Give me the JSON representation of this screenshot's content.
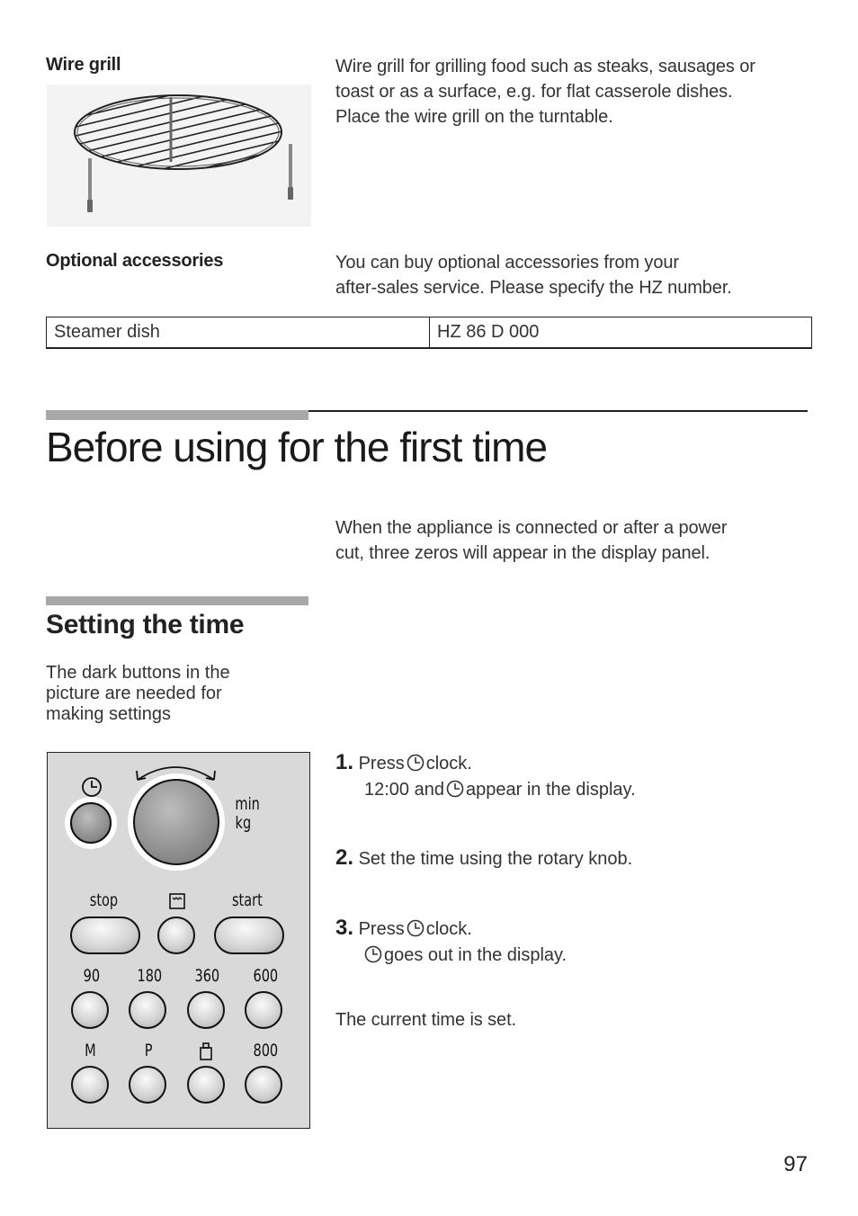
{
  "wire_grill": {
    "label": "Wire grill",
    "description_lines": [
      "Wire grill for grilling food such as steaks, sausages or",
      "toast or as a surface, e.g. for flat casserole dishes.",
      "Place the wire grill on the turntable."
    ],
    "image_icon": "wire-grill-illustration"
  },
  "optional_accessories": {
    "label": "Optional accessories",
    "description_lines": [
      "You can buy optional accessories from your",
      "after-sales service. Please specify the HZ number."
    ],
    "table": {
      "rows": [
        {
          "item": "Steamer dish",
          "hz_number": "HZ 86 D 000"
        }
      ]
    }
  },
  "section": {
    "title": "Before using for the first time",
    "intro_lines": [
      "When the appliance is connected or after a power",
      "cut, three zeros will appear in the display panel."
    ]
  },
  "subsection": {
    "title": "Setting the time",
    "hint_lines": [
      "The dark buttons in the",
      "picture are needed for",
      "making settings"
    ]
  },
  "control_panel": {
    "clock_icon": "clock-icon",
    "knob_arrow_icon": "rotate-arrow-icon",
    "knob_label_1": "min",
    "knob_label_2": "kg",
    "row1": {
      "stop": "stop",
      "grill_icon": "grill-icon",
      "start": "start"
    },
    "row2": [
      "90",
      "180",
      "360",
      "600"
    ],
    "row3": [
      "M",
      "P",
      "weight-icon",
      "800"
    ]
  },
  "steps": [
    {
      "number": "1.",
      "line1_pre": "Press",
      "line1_post": "clock.",
      "line2_pre": "12:00 and",
      "line2_post": "appear in the display."
    },
    {
      "number": "2.",
      "line1": "Set the time using the rotary knob."
    },
    {
      "number": "3.",
      "line1_pre": "Press",
      "line1_post": "clock.",
      "line2_post": "goes out in the display."
    }
  ],
  "conclusion": "The current time is set.",
  "page_number": "97"
}
